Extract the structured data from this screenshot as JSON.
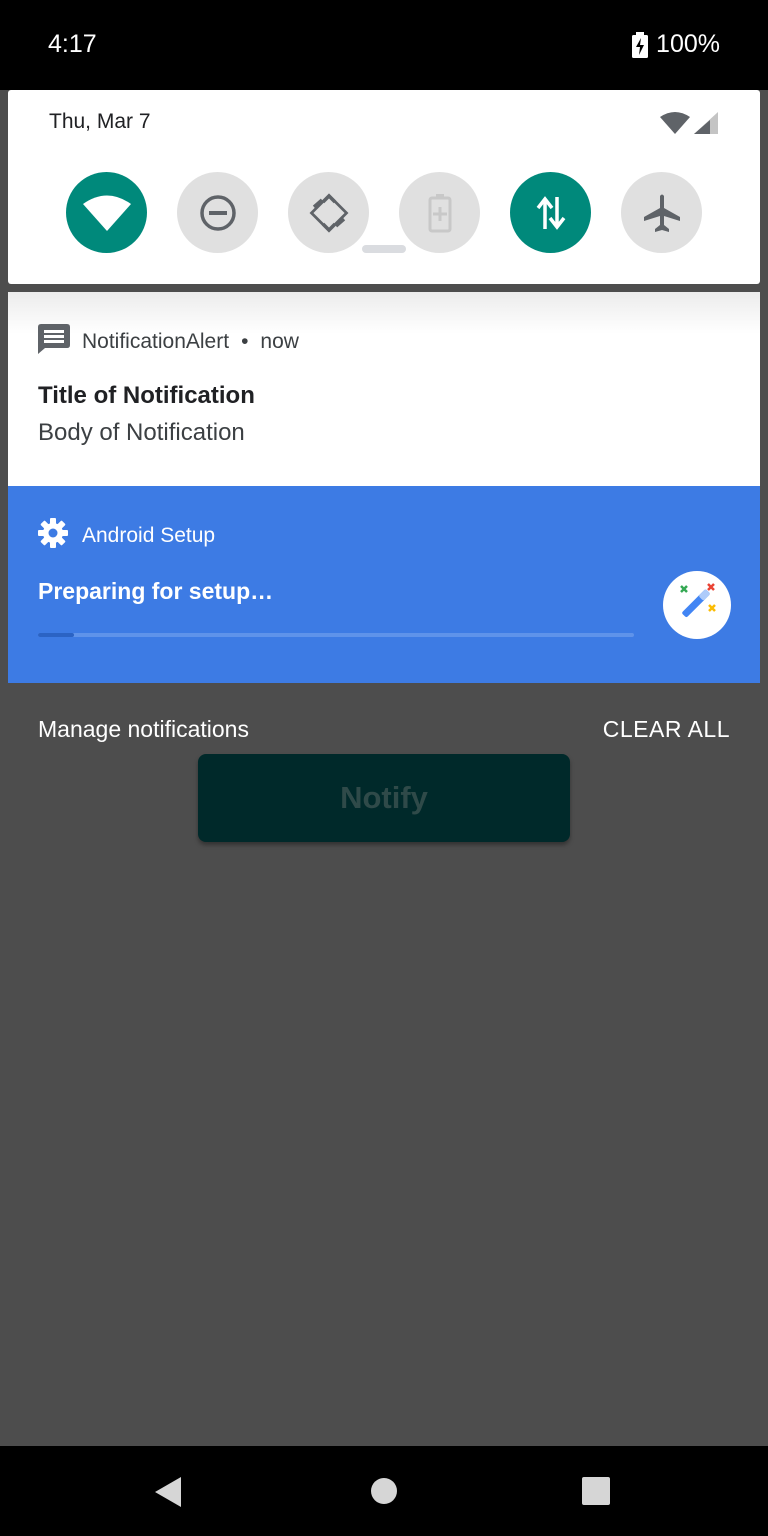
{
  "status_bar": {
    "time": "4:17",
    "battery_text": "100%",
    "battery_icon": "battery-charging-icon"
  },
  "quick_settings": {
    "date": "Thu, Mar 7",
    "tiles": [
      {
        "name": "wifi",
        "icon": "wifi-icon",
        "active": true
      },
      {
        "name": "do-not-disturb",
        "icon": "do-not-disturb-icon",
        "active": false
      },
      {
        "name": "auto-rotate",
        "icon": "rotate-icon",
        "active": false
      },
      {
        "name": "battery-saver",
        "icon": "battery-saver-icon",
        "active": false
      },
      {
        "name": "mobile-data",
        "icon": "mobile-data-icon",
        "active": true
      },
      {
        "name": "airplane-mode",
        "icon": "airplane-icon",
        "active": false
      }
    ],
    "active_color": "#00897b",
    "inactive_color": "#e0e0e0"
  },
  "notifications": [
    {
      "app": "NotificationAlert",
      "separator": "•",
      "time": "now",
      "title": "Title of Notification",
      "body": "Body of Notification",
      "icon": "message-icon"
    },
    {
      "app": "Android Setup",
      "title": "Preparing for setup…",
      "icon": "gear-icon",
      "badge_icon": "magic-wand-icon",
      "progress": 0.06,
      "background": "#3d7be4"
    }
  ],
  "shade_actions": {
    "manage": "Manage notifications",
    "clear_all": "CLEAR ALL"
  },
  "app": {
    "notify_button": "Notify"
  },
  "nav_bar": {
    "back": "back-icon",
    "home": "home-icon",
    "recents": "recents-icon"
  }
}
